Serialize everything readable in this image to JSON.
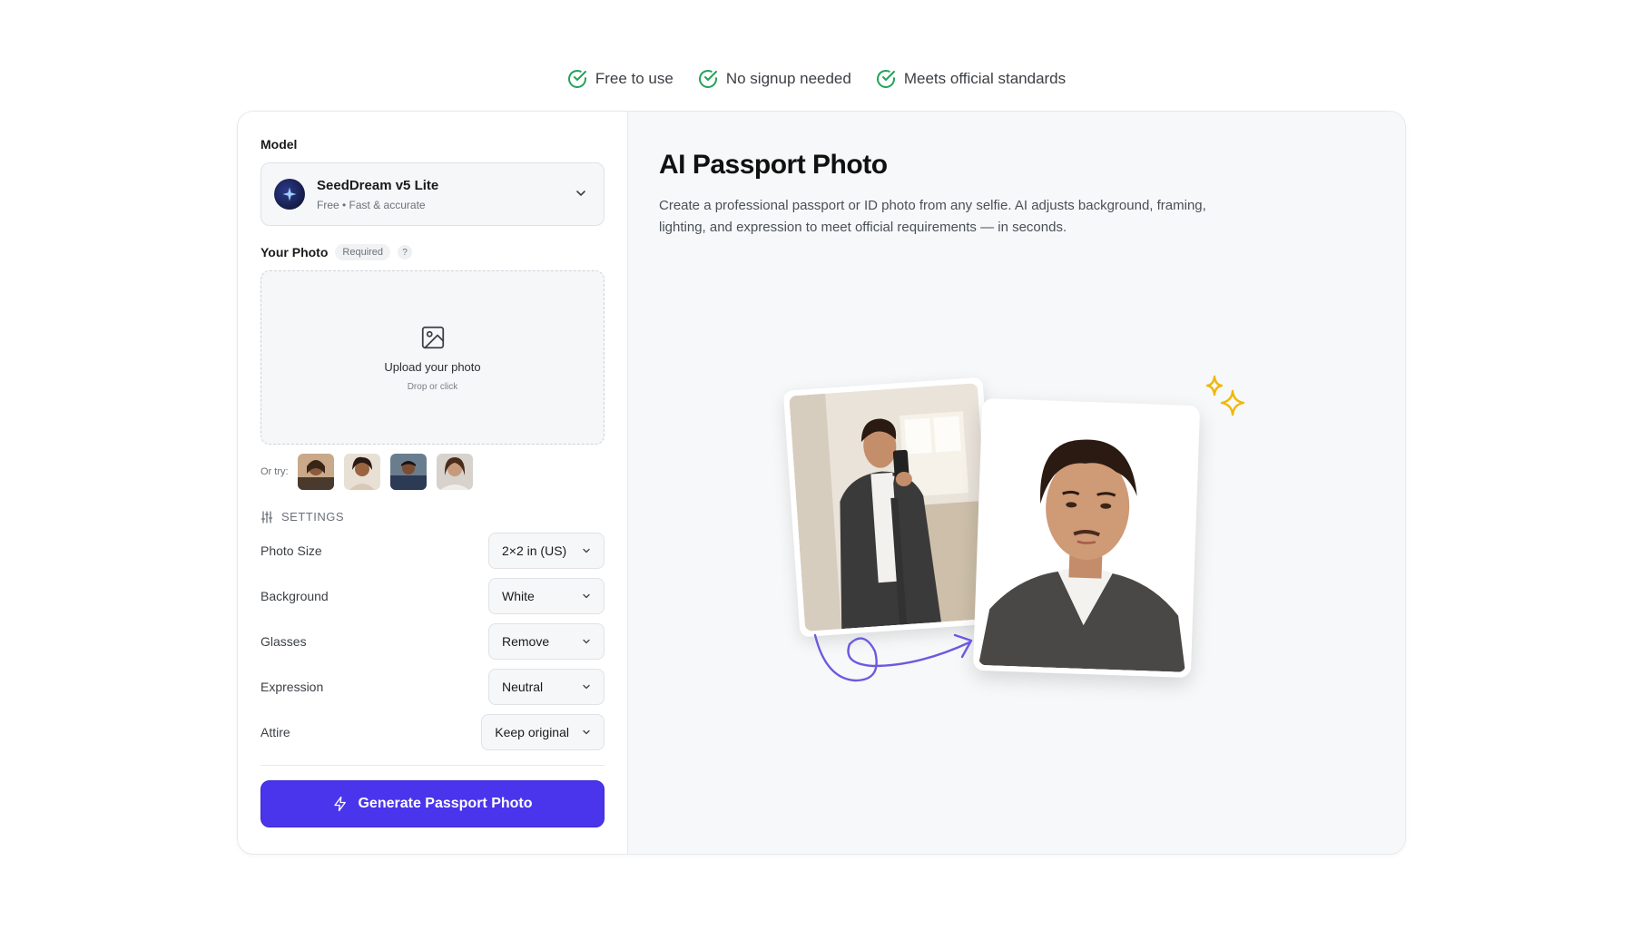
{
  "badges": [
    {
      "icon": "check-circle-icon",
      "label": "Free to use"
    },
    {
      "icon": "check-circle-icon",
      "label": "No signup needed"
    },
    {
      "icon": "check-circle-icon",
      "label": "Meets official standards"
    }
  ],
  "form": {
    "model_label": "Model",
    "model": {
      "name": "SeedDream v5 Lite",
      "subtitle": "Free • Fast & accurate",
      "icon": "sparkle-logo-icon"
    },
    "photo_label": "Your Photo",
    "photo_required": "Required",
    "photo_help": "?",
    "upload_title": "Upload your photo",
    "upload_sub": "Drop or click",
    "try_label": "Or try:",
    "settings_label": "SETTINGS",
    "settings": [
      {
        "label": "Photo Size",
        "value": "2×2 in (US)"
      },
      {
        "label": "Background",
        "value": "White"
      },
      {
        "label": "Glasses",
        "value": "Remove"
      },
      {
        "label": "Expression",
        "value": "Neutral"
      },
      {
        "label": "Attire",
        "value": "Keep original"
      }
    ],
    "generate_label": "Generate Passport Photo"
  },
  "hero": {
    "title": "AI Passport Photo",
    "description": "Create a professional passport or ID photo from any selfie. AI adjusts background, framing, lighting, and expression to meet official requirements — in seconds."
  },
  "colors": {
    "accent": "#4a35ec",
    "check": "#22a35a",
    "sparkle": "#f2b705",
    "arrow": "#6a5ae0"
  }
}
